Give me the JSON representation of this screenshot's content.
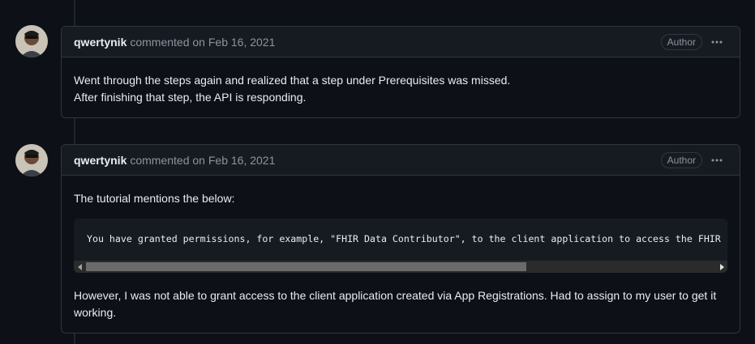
{
  "comments": [
    {
      "author": "qwertynik",
      "meta": "commented on Feb 16, 2021",
      "badge": "Author",
      "lines": [
        "Went through the steps again and realized that a step under Prerequisites was missed.",
        "After finishing that step, the API is responding."
      ]
    },
    {
      "author": "qwertynik",
      "meta": "commented on Feb 16, 2021",
      "badge": "Author",
      "intro": "The tutorial mentions the below:",
      "code": "You have granted permissions, for example, \"FHIR Data Contributor\", to the client application to access the FHIR service.",
      "scroll_thumb_fraction": 0.7,
      "outro_line1": "However, I was not able to grant access to the client application created via App Registrations. Had to assign to my user to get it",
      "outro_line2": "working."
    }
  ],
  "icons": {
    "more": "kebab-horizontal-icon",
    "scroll_left": "triangle-left-icon",
    "scroll_right": "triangle-right-icon"
  },
  "colors": {
    "background": "#0d1117",
    "header_bg": "#161b22",
    "border": "#30363d",
    "muted_text": "#8b949e",
    "text": "#e6edf3"
  }
}
